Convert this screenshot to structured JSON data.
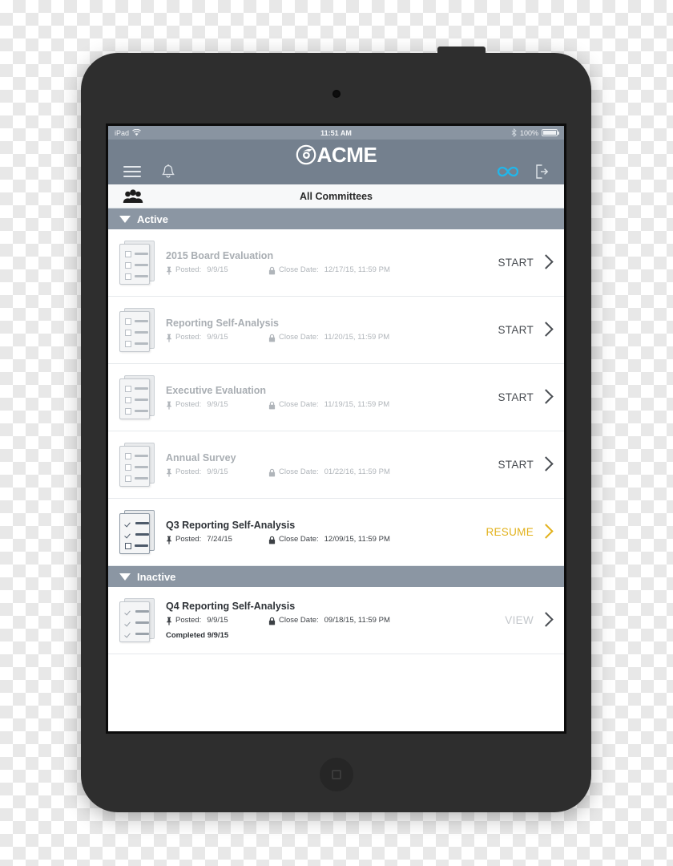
{
  "status_bar": {
    "device_label": "iPad",
    "wifi_icon": "wifi-icon",
    "time": "11:51 AM",
    "bluetooth_icon": "bluetooth-icon",
    "battery_percent": "100%",
    "battery_icon": "battery-full-icon"
  },
  "header": {
    "menu_icon": "hamburger-menu-icon",
    "notifications_icon": "bell-icon",
    "logo_mark": "acme-swirl-logo-icon",
    "logo_text": "ACME",
    "link_icon": "infinity-link-icon",
    "logout_icon": "logout-icon",
    "link_icon_color": "#21b6ea"
  },
  "committees_bar": {
    "group_icon": "people-group-icon",
    "title": "All Committees"
  },
  "sections": [
    {
      "id": "active",
      "caret_icon": "caret-down-icon",
      "label": "Active",
      "rows": [
        {
          "icon": "checklist-unchecked-icon",
          "icon_style": "light",
          "checks": [
            false,
            false,
            false
          ],
          "title": "2015 Board Evaluation",
          "title_style": "muted",
          "pin_icon": "pin-icon",
          "posted_label": "Posted:",
          "posted_value": "9/9/15",
          "lock_icon": "lock-icon",
          "close_label": "Close Date:",
          "close_value": "12/17/15, 11:59 PM",
          "action_label": "START",
          "action_style": "start",
          "chevron_icon": "chevron-right-icon",
          "chevron_style": "dark",
          "completed": ""
        },
        {
          "icon": "checklist-unchecked-icon",
          "icon_style": "light",
          "checks": [
            false,
            false,
            false
          ],
          "title": "Reporting Self-Analysis",
          "title_style": "muted",
          "pin_icon": "pin-icon",
          "posted_label": "Posted:",
          "posted_value": "9/9/15",
          "lock_icon": "lock-icon",
          "close_label": "Close Date:",
          "close_value": "11/20/15, 11:59 PM",
          "action_label": "START",
          "action_style": "start",
          "chevron_icon": "chevron-right-icon",
          "chevron_style": "dark",
          "completed": ""
        },
        {
          "icon": "checklist-unchecked-icon",
          "icon_style": "light",
          "checks": [
            false,
            false,
            false
          ],
          "title": "Executive Evaluation",
          "title_style": "muted",
          "pin_icon": "pin-icon",
          "posted_label": "Posted:",
          "posted_value": "9/9/15",
          "lock_icon": "lock-icon",
          "close_label": "Close Date:",
          "close_value": "11/19/15, 11:59 PM",
          "action_label": "START",
          "action_style": "start",
          "chevron_icon": "chevron-right-icon",
          "chevron_style": "dark",
          "completed": ""
        },
        {
          "icon": "checklist-unchecked-icon",
          "icon_style": "light",
          "checks": [
            false,
            false,
            false
          ],
          "title": "Annual Survey",
          "title_style": "muted",
          "pin_icon": "pin-icon",
          "posted_label": "Posted:",
          "posted_value": "9/9/15",
          "lock_icon": "lock-icon",
          "close_label": "Close Date:",
          "close_value": "01/22/16, 11:59 PM",
          "action_label": "START",
          "action_style": "start",
          "chevron_icon": "chevron-right-icon",
          "chevron_style": "dark",
          "completed": ""
        },
        {
          "icon": "checklist-partial-icon",
          "icon_style": "dark",
          "checks": [
            true,
            true,
            false
          ],
          "title": "Q3 Reporting Self-Analysis",
          "title_style": "strong",
          "pin_icon": "pin-icon",
          "posted_label": "Posted:",
          "posted_value": "7/24/15",
          "lock_icon": "lock-icon",
          "close_label": "Close Date:",
          "close_value": "12/09/15, 11:59 PM",
          "action_label": "RESUME",
          "action_style": "resume",
          "chevron_icon": "chevron-right-icon",
          "chevron_style": "gold",
          "completed": ""
        }
      ]
    },
    {
      "id": "inactive",
      "caret_icon": "caret-down-icon",
      "label": "Inactive",
      "rows": [
        {
          "icon": "checklist-complete-icon",
          "icon_style": "midlight",
          "checks": [
            true,
            true,
            true
          ],
          "title": "Q4 Reporting Self-Analysis",
          "title_style": "strong",
          "pin_icon": "pin-icon",
          "posted_label": "Posted:",
          "posted_value": "9/9/15",
          "lock_icon": "lock-icon",
          "close_label": "Close Date:",
          "close_value": "09/18/15, 11:59 PM",
          "action_label": "VIEW",
          "action_style": "view",
          "chevron_icon": "chevron-right-icon",
          "chevron_style": "dark",
          "completed": "Completed 9/9/15"
        }
      ]
    }
  ],
  "device": {
    "camera_icon": "front-camera-icon",
    "home_button": "home-button"
  },
  "colors": {
    "header_bg": "#74808e",
    "section_bg": "#8b96a3",
    "accent_cyan": "#21b6ea",
    "accent_gold": "#e2b21d"
  }
}
